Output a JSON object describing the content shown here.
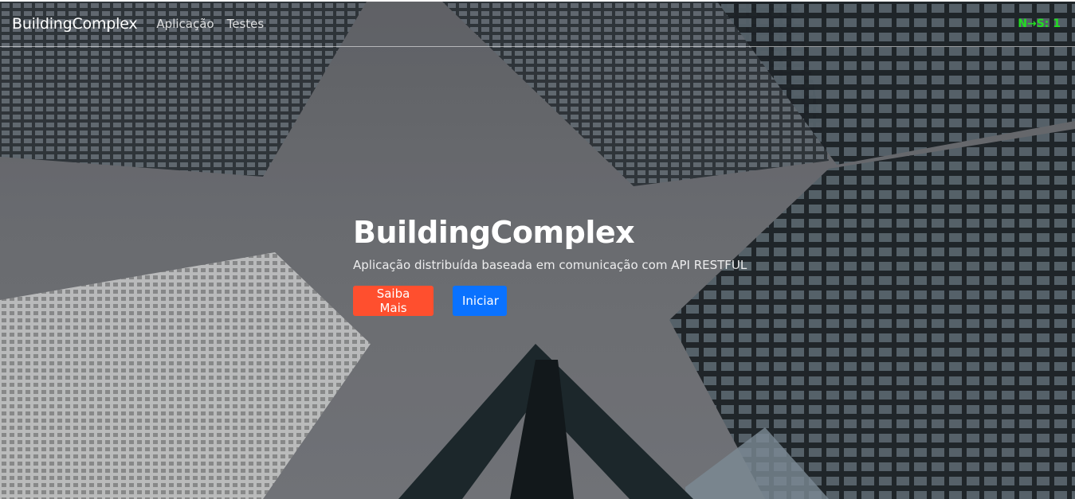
{
  "navbar": {
    "brand": "BuildingComplex",
    "links": [
      {
        "label": "Aplicação"
      },
      {
        "label": "Testes"
      }
    ],
    "indicator": "N→S: 1"
  },
  "hero": {
    "title": "BuildingComplex",
    "subtitle": "Aplicação distribuída baseada em comunicação com API RESTFUL",
    "buttons": {
      "more": "Saiba Mais",
      "start": "Iniciar"
    }
  },
  "colors": {
    "more_button": "#ff4f2e",
    "start_button": "#0a72ff",
    "indicator": "#22dd22"
  }
}
